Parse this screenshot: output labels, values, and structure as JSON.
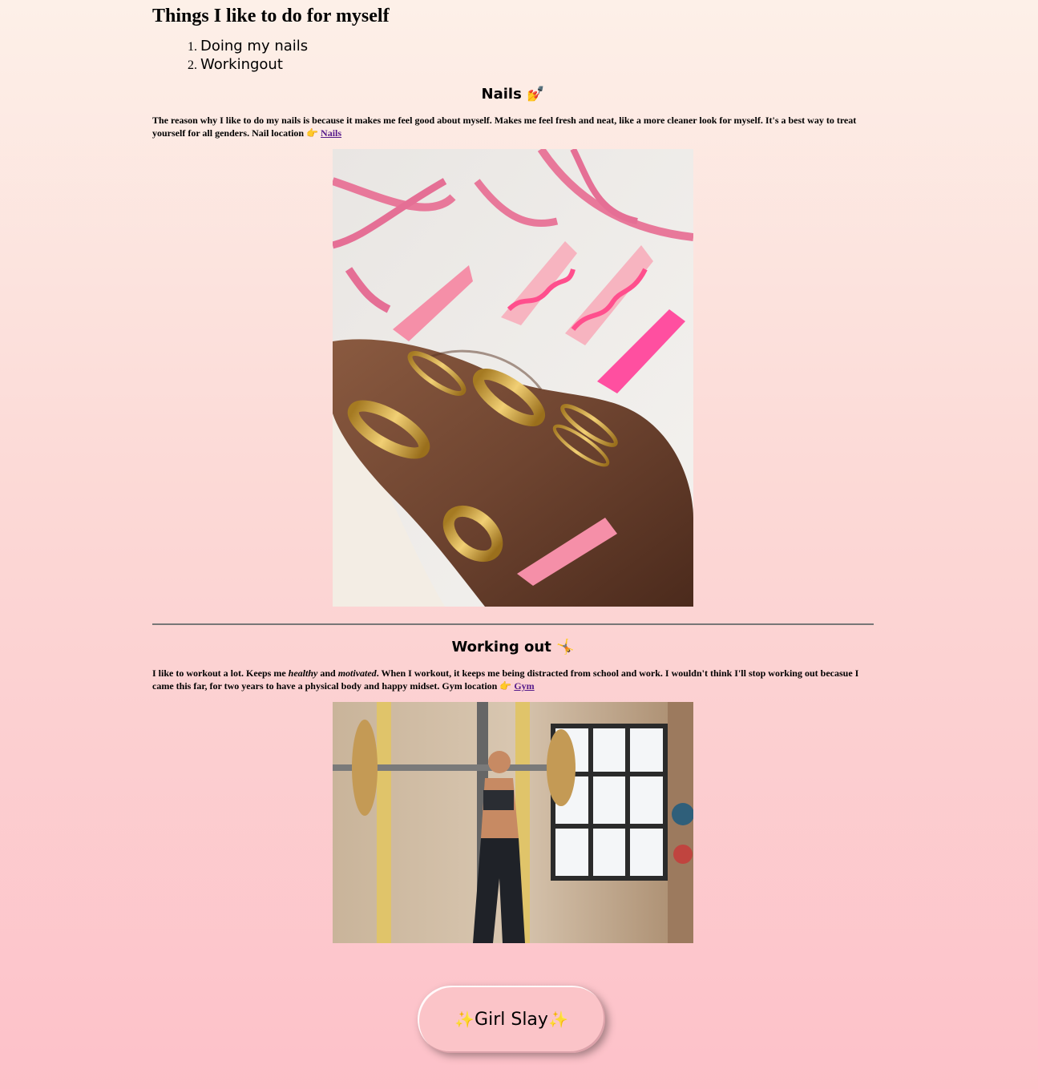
{
  "page": {
    "title": "Things I like to do for myself",
    "list": [
      "Doing my nails",
      "Workingout"
    ]
  },
  "nails": {
    "heading": "Nails",
    "heading_icon": "💅",
    "text": "The reason why I like to do my nails is because it makes me feel good about myself. Makes me feel fresh and neat, like a more cleaner look for myself. It's a best way to treat yourself for all genders. Nail location",
    "pointer_icon": "👉",
    "link_label": "Nails",
    "image_icon": "photo-of-pink-nails"
  },
  "workout": {
    "heading": "Working out",
    "heading_icon": "🤸",
    "text_1": "I like to workout a lot. Keeps me ",
    "text_healthy": "healthy",
    "text_and": " and ",
    "text_motivated": "motivated",
    "text_2": ". When I workout, it keeps me being distracted from school and work. I wouldn't think I'll stop working out becasue I came this far, for two years to have a physical body and happy midset. Gym location",
    "pointer_icon": "👉",
    "link_label": "Gym",
    "image_icon": "photo-of-gym-workout"
  },
  "button": {
    "label": "Girl Slay",
    "sparkle": "✨"
  },
  "colors": {
    "link": "#551a8b",
    "button_bg": "#fbc4c8",
    "nail_pink": "#f58fa8",
    "nail_hot_pink": "#ff4fa0"
  }
}
